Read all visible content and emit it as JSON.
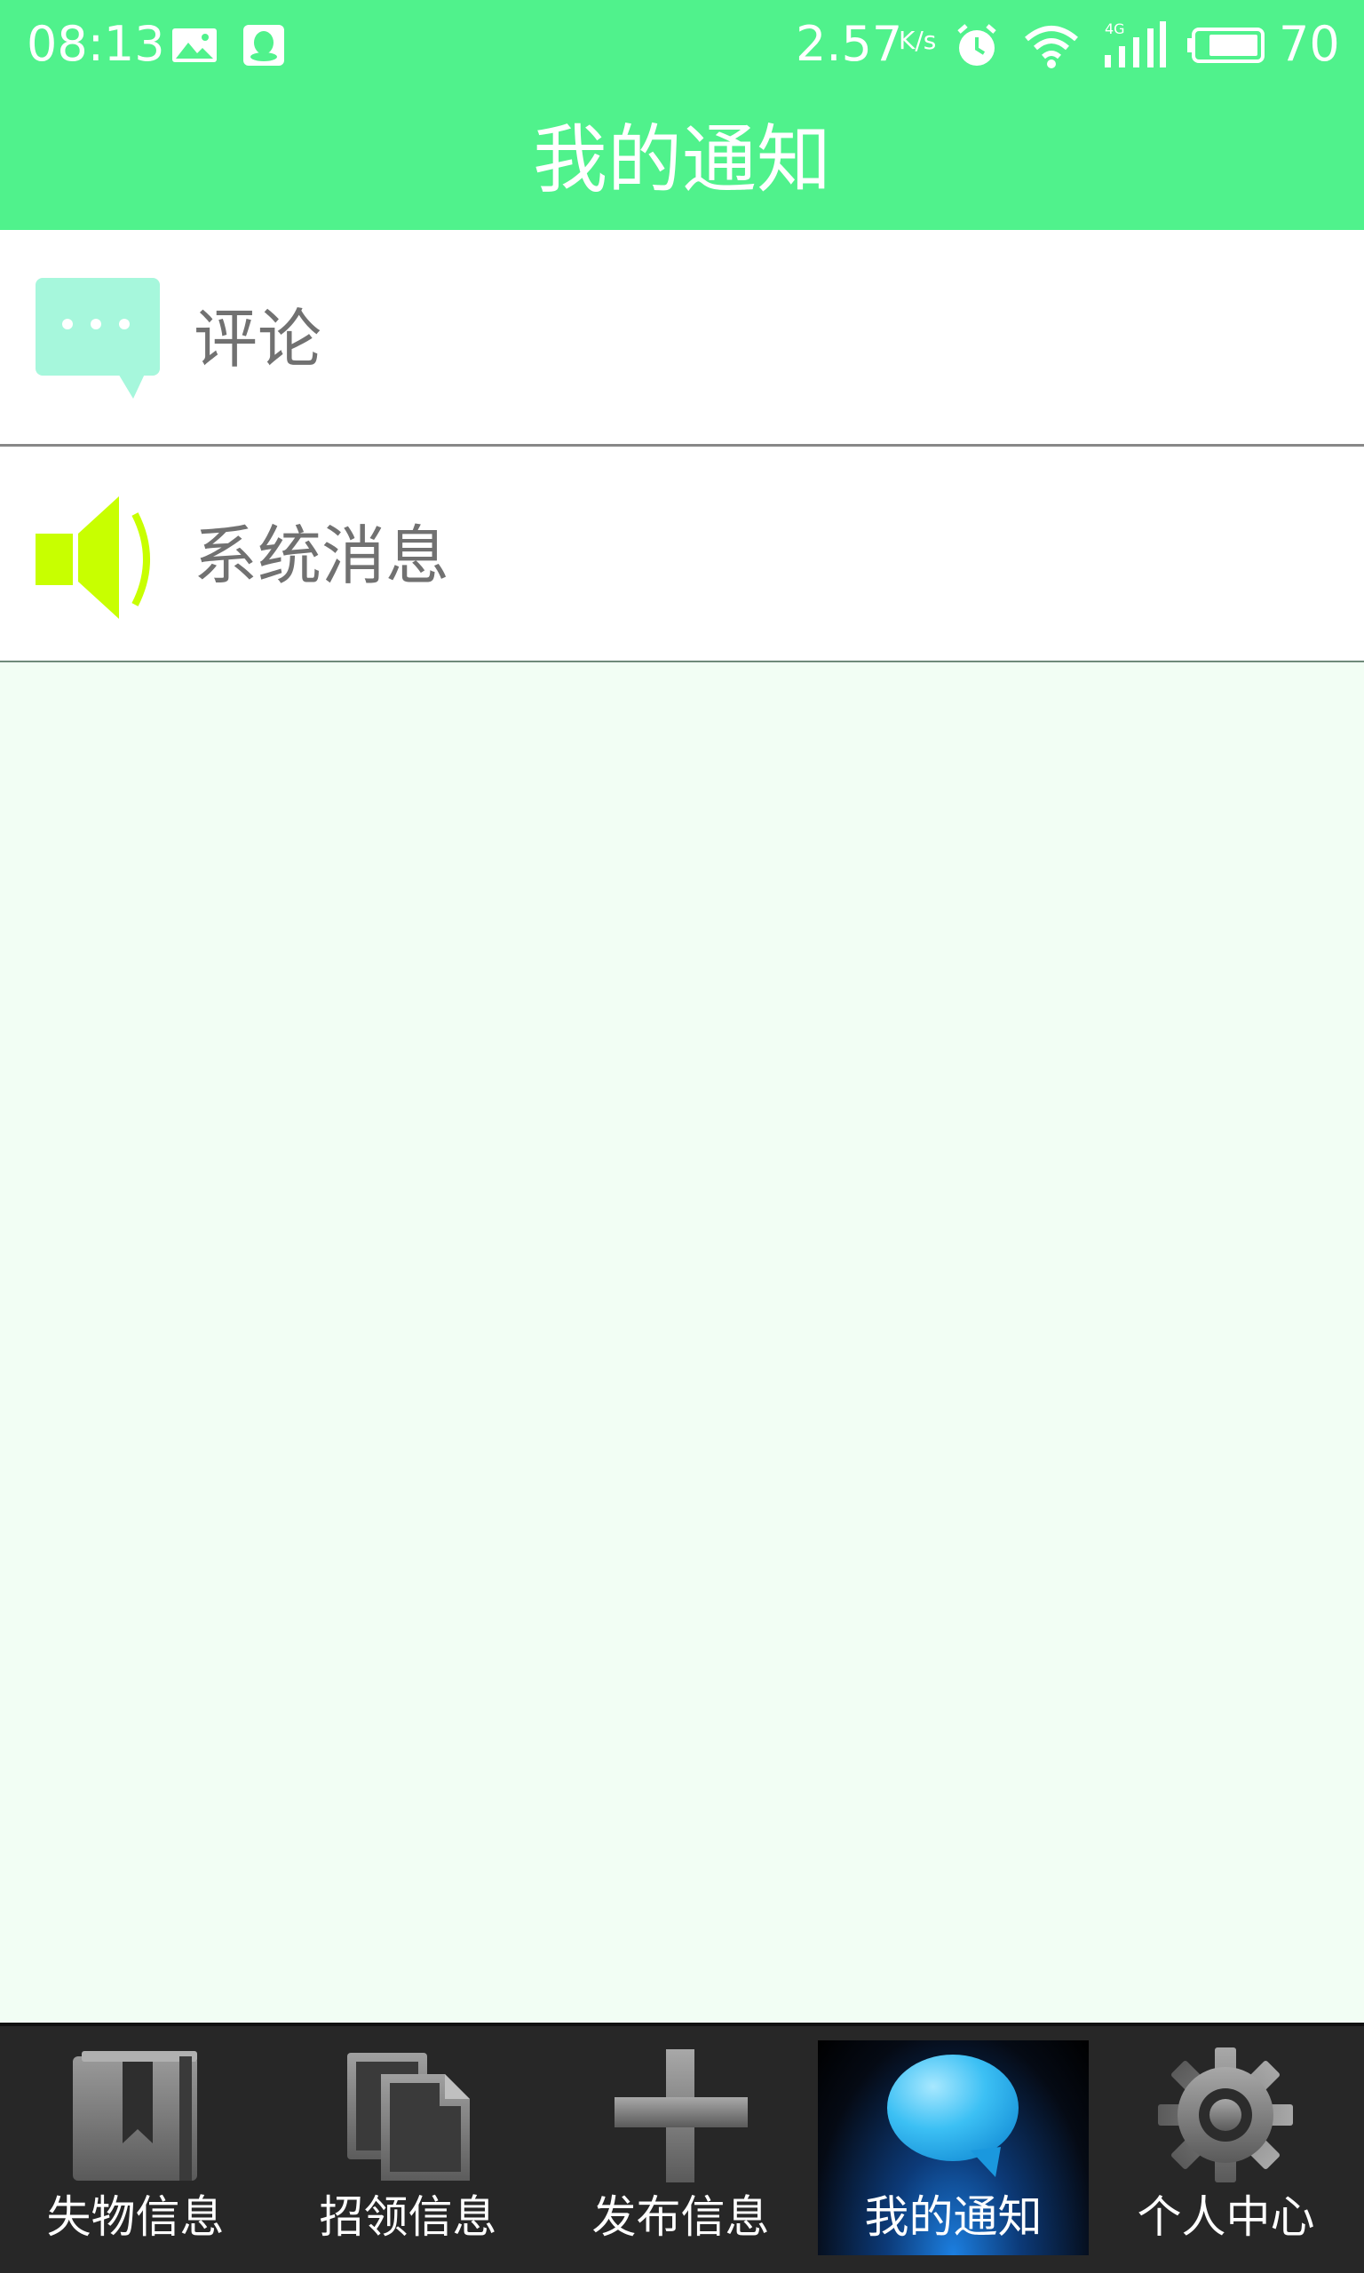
{
  "status_bar": {
    "time": "08:13",
    "network_speed": "2.57",
    "network_speed_unit": "K/s",
    "signal_type": "4G",
    "battery": "70",
    "icons": [
      "image-icon",
      "qq-icon",
      "alarm-icon",
      "wifi-icon",
      "signal-icon",
      "battery-icon"
    ]
  },
  "header": {
    "title": "我的通知"
  },
  "list": {
    "items": [
      {
        "label": "评论",
        "icon": "comment-bubble-icon",
        "icon_color": "#a6f7dc"
      },
      {
        "label": "系统消息",
        "icon": "speaker-icon",
        "icon_color": "#c8ff00"
      }
    ]
  },
  "bottom_nav": {
    "tabs": [
      {
        "label": "失物信息",
        "icon": "book-bookmark-icon",
        "active": false
      },
      {
        "label": "招领信息",
        "icon": "documents-icon",
        "active": false
      },
      {
        "label": "发布信息",
        "icon": "plus-icon",
        "active": false
      },
      {
        "label": "我的通知",
        "icon": "chat-bubble-icon",
        "active": true
      },
      {
        "label": "个人中心",
        "icon": "gear-icon",
        "active": false
      }
    ]
  },
  "colors": {
    "header_bg": "#50f28c",
    "page_bg": "#f2fef4",
    "nav_bg": "#272727",
    "active_tab_glow": "#1c7fe0",
    "item_text": "#717171"
  }
}
